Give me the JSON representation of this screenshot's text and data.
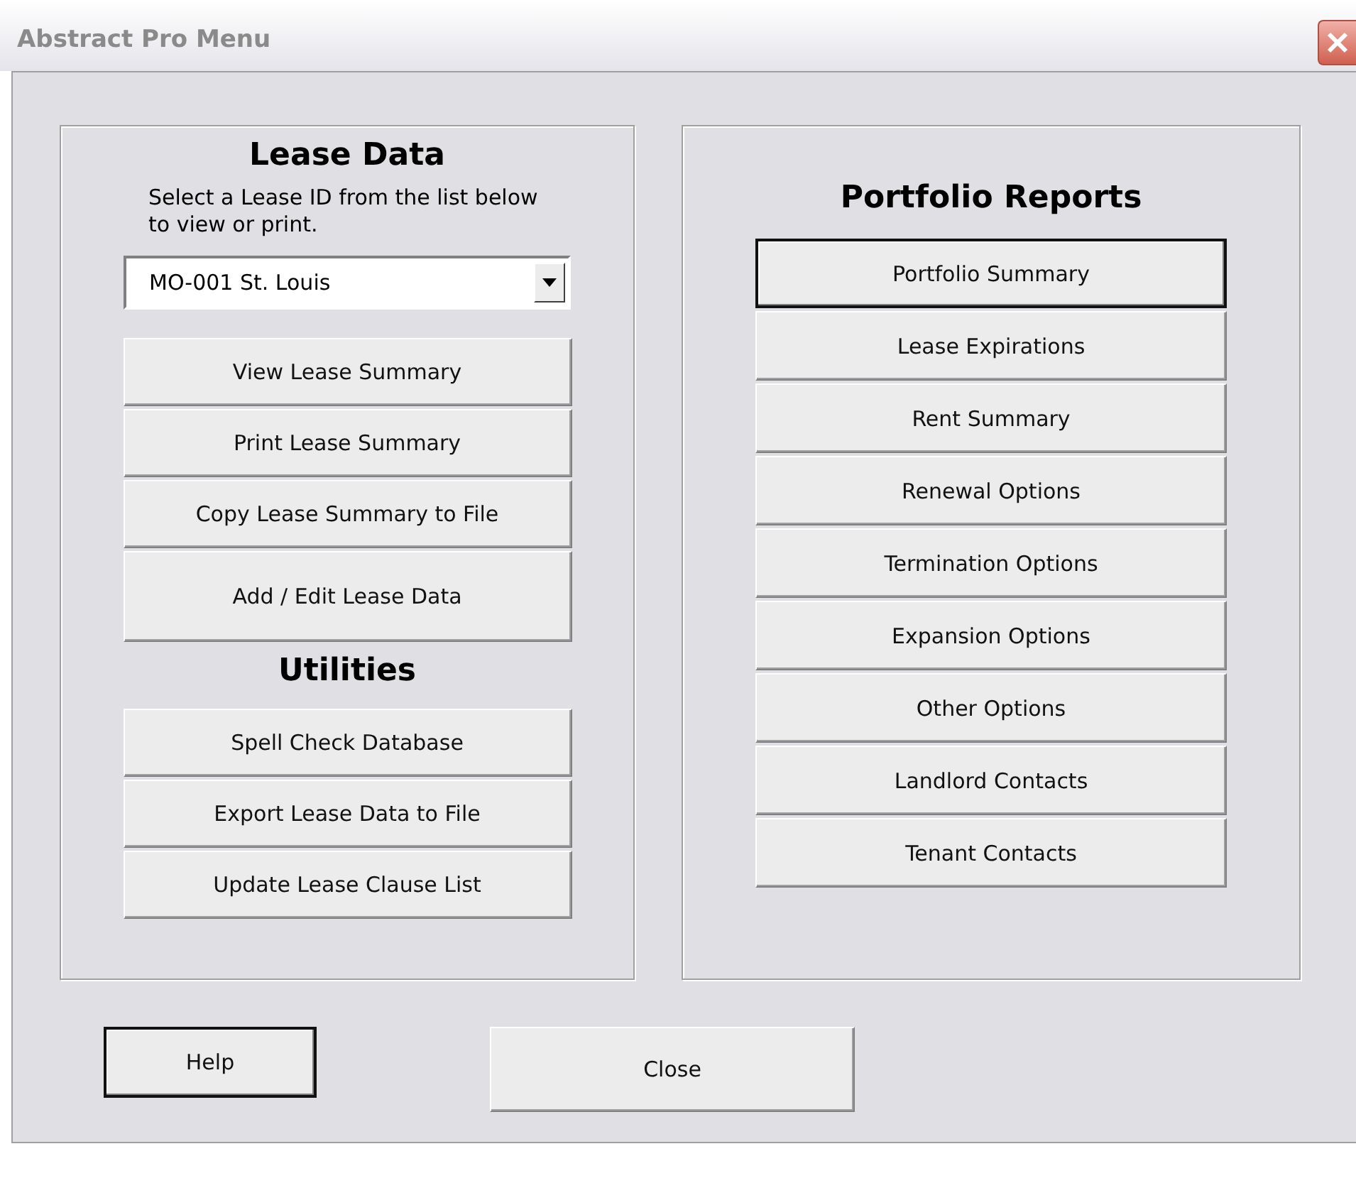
{
  "window": {
    "title": "Abstract Pro Menu"
  },
  "lease_data": {
    "heading": "Lease Data",
    "instructions": "Select a Lease ID from the list below to view or print.",
    "lease_select": {
      "value": "MO-001 St. Louis"
    },
    "buttons": [
      {
        "label": "View Lease Summary",
        "focused": false
      },
      {
        "label": "Print Lease Summary",
        "focused": false
      },
      {
        "label": "Copy Lease Summary to File",
        "focused": false
      },
      {
        "label": "Add / Edit Lease Data",
        "focused": false
      }
    ]
  },
  "utilities": {
    "heading": "Utilities",
    "buttons": [
      {
        "label": "Spell Check Database",
        "focused": false
      },
      {
        "label": "Export Lease Data to File",
        "focused": false
      },
      {
        "label": "Update Lease Clause List",
        "focused": false
      }
    ]
  },
  "portfolio_reports": {
    "heading": "Portfolio Reports",
    "buttons": [
      {
        "label": "Portfolio Summary",
        "focused": true
      },
      {
        "label": "Lease Expirations",
        "focused": false
      },
      {
        "label": "Rent Summary",
        "focused": false
      },
      {
        "label": "Renewal Options",
        "focused": false
      },
      {
        "label": "Termination Options",
        "focused": false
      },
      {
        "label": "Expansion Options",
        "focused": false
      },
      {
        "label": "Other Options",
        "focused": false
      },
      {
        "label": "Landlord Contacts",
        "focused": false
      },
      {
        "label": "Tenant Contacts",
        "focused": false
      }
    ]
  },
  "footer_buttons": [
    {
      "label": "Help",
      "focused": true
    },
    {
      "label": "Close",
      "focused": false
    }
  ]
}
